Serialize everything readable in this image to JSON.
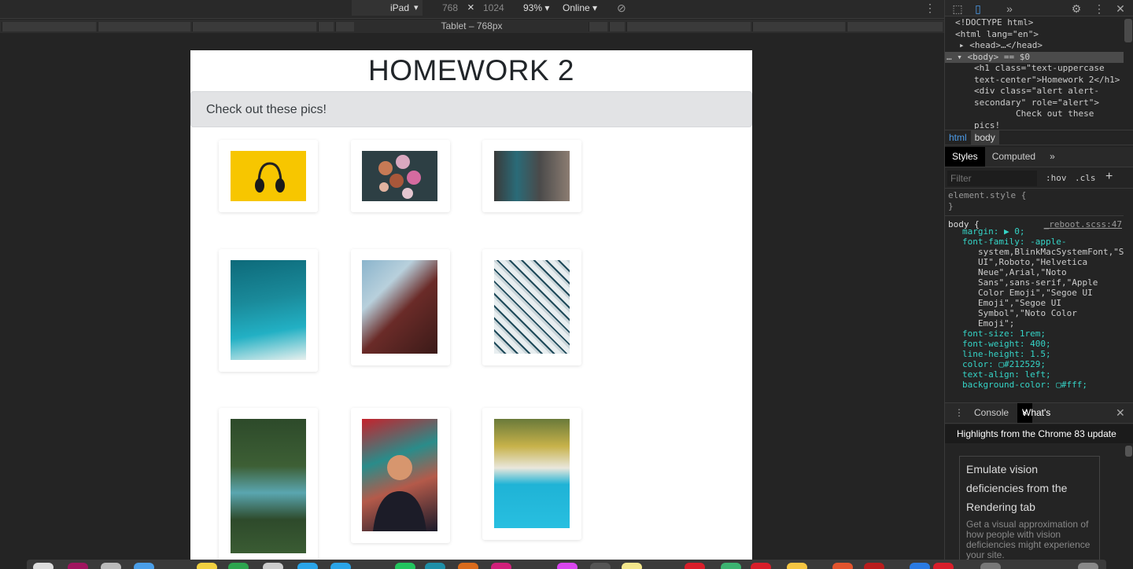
{
  "device_toolbar": {
    "device": "iPad",
    "width": "768",
    "times": "×",
    "height": "1024",
    "zoom": "93%",
    "network": "Online",
    "media_label": "Tablet – 768px"
  },
  "page": {
    "title": "HOMEWORK 2",
    "alert_text": "Check out these pics!",
    "photos": [
      {
        "subject": "headphones on yellow"
      },
      {
        "subject": "donuts top view"
      },
      {
        "subject": "woman by window"
      },
      {
        "subject": "turquoise reef aerial"
      },
      {
        "subject": "curved building"
      },
      {
        "subject": "apartment facade"
      },
      {
        "subject": "palm forest river aerial"
      },
      {
        "subject": "person with graffiti"
      },
      {
        "subject": "beach and palms inverted"
      }
    ]
  },
  "devtools": {
    "elements": {
      "doctype": "<!DOCTYPE html>",
      "html_open": "<html lang=\"en\">",
      "head": "<head>…</head>",
      "body": "<body> == $0",
      "h1_a": "<h1 class=\"text-uppercase",
      "h1_b": "text-center\">Homework 2</h1>",
      "div_a": "<div class=\"alert alert-",
      "div_b": "secondary\" role=\"alert\">",
      "div_c": "Check out these",
      "div_d": "pics!"
    },
    "breadcrumbs": [
      "html",
      "body"
    ],
    "tabs": {
      "styles": "Styles",
      "computed": "Computed"
    },
    "filter": {
      "placeholder": "Filter",
      "hov": ":hov",
      "cls": ".cls",
      "plus": "+"
    },
    "styles": {
      "element_style": "element.style {",
      "close_brace": "}",
      "body_selector": "body {",
      "source": "_reboot.scss:47",
      "margin": "margin: ▶ 0;",
      "font_family_1": "font-family: -apple-",
      "font_family_2": "system,BlinkMacSystemFont,\"S",
      "font_family_3": "UI\",Roboto,\"Helvetica",
      "font_family_4": "Neue\",Arial,\"Noto",
      "font_family_5": "Sans\",sans-serif,\"Apple",
      "font_family_6": "Color Emoji\",\"Segoe UI",
      "font_family_7": "Emoji\",\"Segoe UI",
      "font_family_8": "Symbol\",\"Noto Color",
      "font_family_9": "Emoji\";",
      "font_size": "font-size: 1rem;",
      "font_weight": "font-weight: 400;",
      "line_height": "line-height: 1.5;",
      "color": "color: ▢#212529;",
      "text_align": "text-align: left;",
      "background_color": "background-color: ▢#fff;"
    },
    "drawer": {
      "console": "Console",
      "whats_new": "What's New",
      "highlights": "Highlights from the Chrome 83 update",
      "card_title_1": "Emulate vision",
      "card_title_2": "deficiencies from the",
      "card_title_3": "Rendering tab",
      "card_body": "Get a visual approximation of how people with vision deficiencies might experience your site."
    }
  },
  "colors": {
    "page_bg": "#ffffff",
    "alert_bg": "#e2e3e5",
    "devtools_bg": "#242424",
    "selected_tab": "#000000"
  }
}
